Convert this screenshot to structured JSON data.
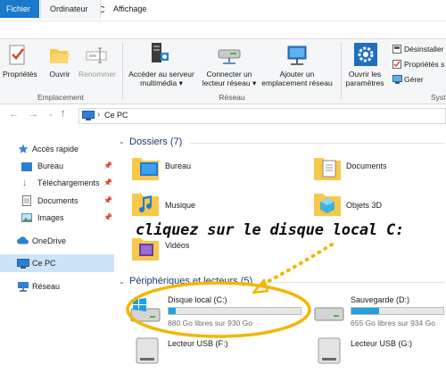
{
  "window": {
    "title": "Ce PC"
  },
  "ribbon": {
    "tabs": [
      "Fichier",
      "Ordinateur",
      "Affichage"
    ],
    "groups": {
      "emplacement": {
        "label": "Emplacement",
        "buttons": [
          "Propriétés",
          "Ouvrir",
          "Renommer"
        ]
      },
      "reseau": {
        "label": "Réseau",
        "buttons": [
          {
            "line1": "Accéder au serveur",
            "line2": "multimédia ▾"
          },
          {
            "line1": "Connecter un",
            "line2": "lecteur réseau ▾"
          },
          {
            "line1": "Ajouter un",
            "line2": "emplacement réseau"
          }
        ]
      },
      "systeme": {
        "label": "Syst",
        "open_settings": {
          "line1": "Ouvrir les",
          "line2": "paramètres"
        },
        "small_buttons": [
          "Désinstaller",
          "Propriétés s",
          "Gérer"
        ]
      }
    }
  },
  "addressbar": {
    "path": "Ce PC",
    "separator": "›"
  },
  "sidebar": {
    "quick_access": "Accès rapide",
    "pinned": [
      "Bureau",
      "Téléchargements",
      "Documents",
      "Images"
    ],
    "onedrive": "OneDrive",
    "this_pc": "Ce PC",
    "network": "Réseau"
  },
  "main": {
    "folders_section": "Dossiers (7)",
    "folders": [
      "Bureau",
      "Documents",
      "Musique",
      "Objets 3D",
      "Vidéos"
    ],
    "devices_section": "Périphériques et lecteurs (5)",
    "drives": [
      {
        "name": "Disque local (C:)",
        "free": "880 Go libres sur 930 Go",
        "used_fraction": 0.054
      },
      {
        "name": "Sauvegarde (D:)",
        "free": "655 Go libres sur 934 Go",
        "used_fraction": 0.299
      },
      {
        "name": "Lecteur USB (F:)"
      },
      {
        "name": "Lecteur USB (G:)"
      }
    ]
  },
  "annotation": {
    "text": "cliquez sur le disque local C:",
    "color": "#f2b705"
  },
  "colors": {
    "accent": "#1979ca",
    "folder": "#f8c84a",
    "drive_bar": "#26a0da"
  }
}
